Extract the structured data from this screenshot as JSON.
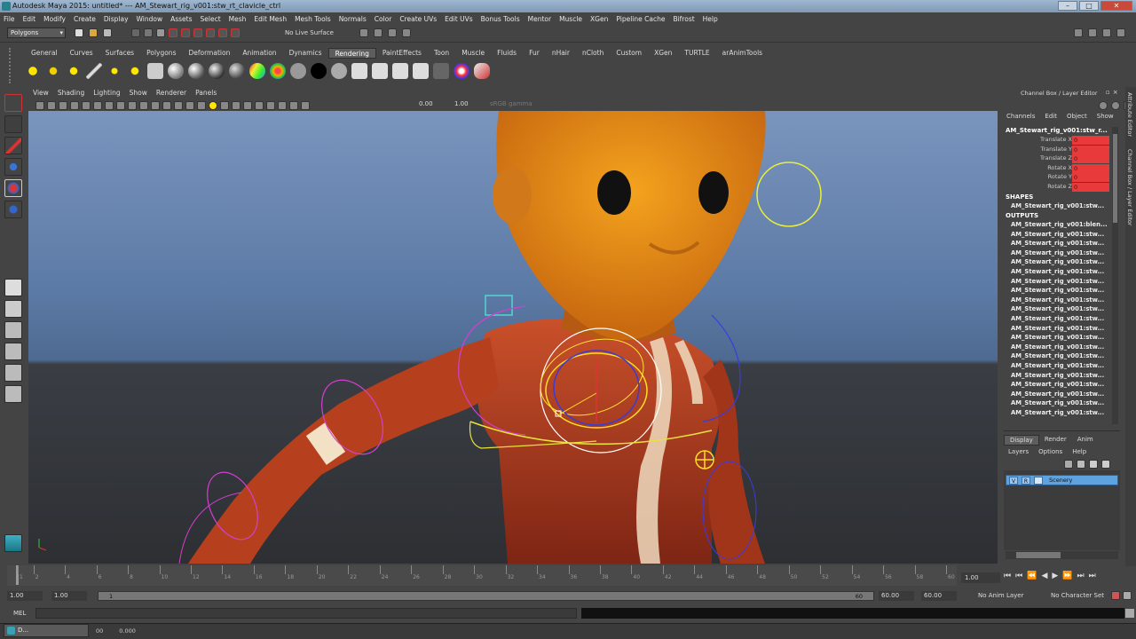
{
  "window": {
    "title": "Autodesk Maya 2015: untitled*   ---   AM_Stewart_rig_v001:stw_rt_clavicle_ctrl"
  },
  "menubar": [
    "File",
    "Edit",
    "Modify",
    "Create",
    "Display",
    "Window",
    "Assets",
    "Select",
    "Mesh",
    "Edit Mesh",
    "Mesh Tools",
    "Normals",
    "Color",
    "Create UVs",
    "Edit UVs",
    "Bonus Tools",
    "Mentor",
    "Muscle",
    "XGen",
    "Pipeline Cache",
    "Bifrost",
    "Help"
  ],
  "status_line": {
    "mode": "Polygons",
    "live_surface": "No Live Surface"
  },
  "shelf_tabs": [
    "General",
    "Curves",
    "Surfaces",
    "Polygons",
    "Deformation",
    "Animation",
    "Dynamics",
    "Rendering",
    "PaintEffects",
    "Toon",
    "Muscle",
    "Fluids",
    "Fur",
    "nHair",
    "nCloth",
    "Custom",
    "XGen",
    "TURTLE",
    "arAnimTools"
  ],
  "active_shelf_tab": "Rendering",
  "viewport": {
    "menus": [
      "View",
      "Shading",
      "Lighting",
      "Show",
      "Renderer",
      "Panels"
    ],
    "field_a": "0.00",
    "field_b": "1.00",
    "color_mgmt": "sRGB gamma"
  },
  "channel_box": {
    "header": "Channel Box / Layer Editor",
    "menus": [
      "Channels",
      "Edit",
      "Object",
      "Show"
    ],
    "object": "AM_Stewart_rig_v001:stw_r...",
    "attributes": [
      {
        "label": "Translate X",
        "value": "0"
      },
      {
        "label": "Translate Y",
        "value": "0"
      },
      {
        "label": "Translate Z",
        "value": "0"
      },
      {
        "label": "Rotate X",
        "value": "0"
      },
      {
        "label": "Rotate Y",
        "value": "0"
      },
      {
        "label": "Rotate Z",
        "value": "0"
      }
    ],
    "shapes_label": "SHAPES",
    "shapes": [
      "AM_Stewart_rig_v001:stw..."
    ],
    "outputs_label": "OUTPUTS",
    "outputs": [
      "AM_Stewart_rig_v001:blen...",
      "AM_Stewart_rig_v001:stw...",
      "AM_Stewart_rig_v001:stw...",
      "AM_Stewart_rig_v001:stw...",
      "AM_Stewart_rig_v001:stw...",
      "AM_Stewart_rig_v001:stw...",
      "AM_Stewart_rig_v001:stw...",
      "AM_Stewart_rig_v001:stw...",
      "AM_Stewart_rig_v001:stw...",
      "AM_Stewart_rig_v001:stw...",
      "AM_Stewart_rig_v001:stw...",
      "AM_Stewart_rig_v001:stw...",
      "AM_Stewart_rig_v001:stw...",
      "AM_Stewart_rig_v001:stw...",
      "AM_Stewart_rig_v001:stw...",
      "AM_Stewart_rig_v001:stw...",
      "AM_Stewart_rig_v001:stw...",
      "AM_Stewart_rig_v001:stw...",
      "AM_Stewart_rig_v001:stw...",
      "AM_Stewart_rig_v001:stw...",
      "AM_Stewart_rig_v001:stw...",
      "AM_Stewart_rig_v001:stw..."
    ]
  },
  "side_tabs": [
    "Attribute Editor",
    "Channel Box / Layer Editor"
  ],
  "layer_editor": {
    "tabs": [
      "Display",
      "Render",
      "Anim"
    ],
    "active_tab": "Display",
    "menus": [
      "Layers",
      "Options",
      "Help"
    ],
    "layer": {
      "v": "V",
      "r": "R",
      "name": "Scenery"
    }
  },
  "timeline": {
    "ticks": [
      "1",
      "2",
      "4",
      "6",
      "8",
      "10",
      "12",
      "14",
      "16",
      "18",
      "20",
      "22",
      "24",
      "26",
      "28",
      "30",
      "32",
      "34",
      "36",
      "38",
      "40",
      "42",
      "44",
      "46",
      "48",
      "50",
      "52",
      "54",
      "56",
      "58",
      "60"
    ],
    "current_frame": "1.00"
  },
  "range": {
    "start": "1.00",
    "start_inner": "1.00",
    "slider_start": "1",
    "slider_end": "60",
    "end_inner": "60.00",
    "end": "60.00",
    "anim_layer": "No Anim Layer",
    "character_set": "No Character Set"
  },
  "command_line": {
    "label": "MEL"
  },
  "taskbar": {
    "button": "D...",
    "values": [
      "00",
      "0.000"
    ]
  }
}
